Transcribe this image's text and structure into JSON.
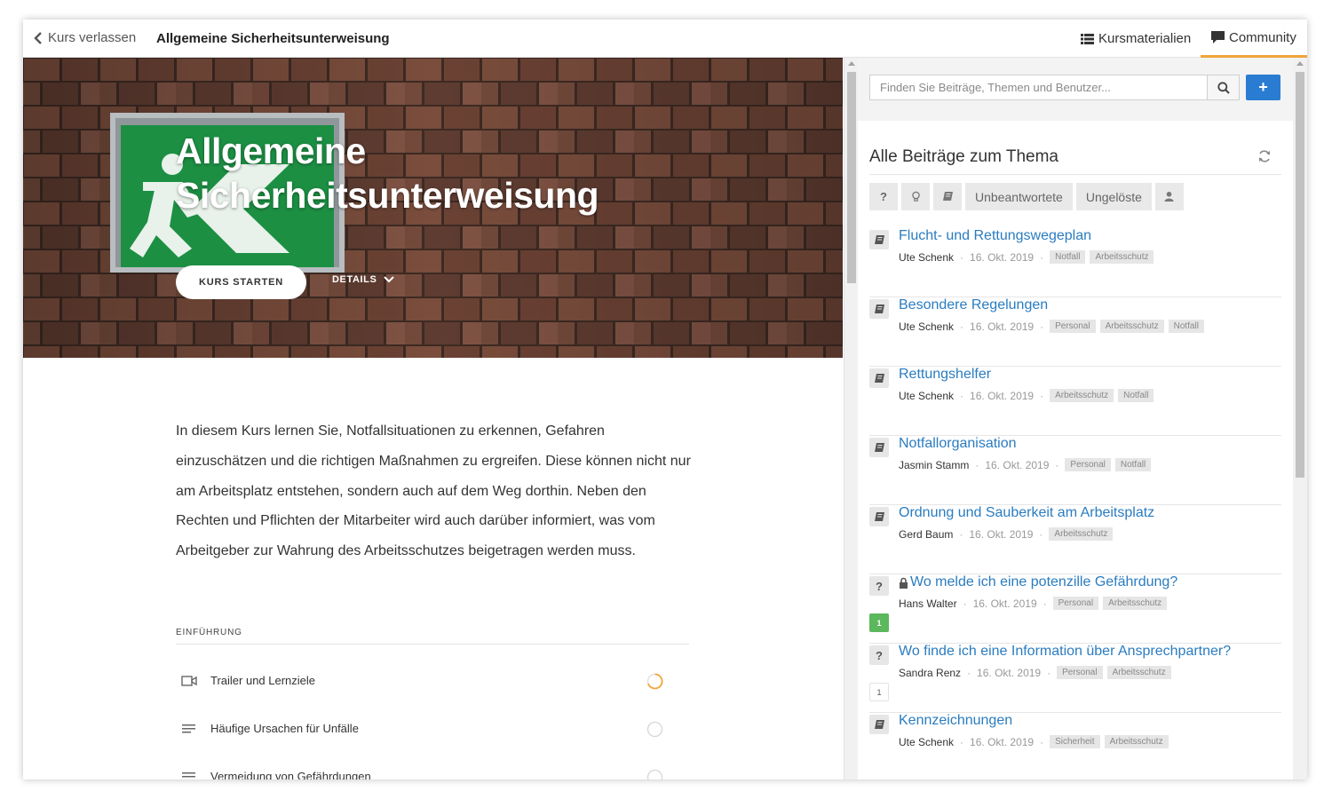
{
  "topbar": {
    "back_label": "Kurs verlassen",
    "course_title": "Allgemeine Sicherheitsunterweisung",
    "tabs": [
      {
        "label": "Kursmaterialien",
        "icon": "list-icon",
        "active": false
      },
      {
        "label": "Community",
        "icon": "comment-icon",
        "active": true
      }
    ],
    "active_tab_color": "#f0a53a"
  },
  "hero": {
    "title": "Allgemeine Sicherheitsunterweisung",
    "start_label": "KURS STARTEN",
    "details_label": "DETAILS"
  },
  "course": {
    "description": "In diesem Kurs lernen Sie, Notfallsituationen zu erkennen, Gefahren einzuschätzen und die richtigen Maßnahmen zu ergreifen. Diese können nicht nur am Arbeitsplatz entstehen, sondern auch auf dem Weg dorthin. Neben den Rechten und Pflichten der Mitarbeiter wird auch darüber informiert, was vom Arbeitgeber zur Wahrung des Arbeitsschutzes beigetragen werden muss.",
    "section_label": "EINFÜHRUNG",
    "lessons": [
      {
        "label": "Trailer und Lernziele",
        "icon": "video-icon",
        "status": "in-progress"
      },
      {
        "label": "Häufige Ursachen für Unfälle",
        "icon": "text-lines-icon",
        "status": "not-started"
      },
      {
        "label": "Vermeidung von Gefährdungen",
        "icon": "text-lines-icon",
        "status": "not-started"
      }
    ],
    "progress_color": "#f0a53a"
  },
  "community": {
    "search_placeholder": "Finden Sie Beiträge, Themen und Benutzer...",
    "add_label": "+",
    "heading": "Alle Beiträge zum Thema",
    "filters": [
      {
        "label": "?",
        "icon": "question-icon"
      },
      {
        "label": "",
        "icon": "lightbulb-icon"
      },
      {
        "label": "",
        "icon": "book-icon"
      },
      {
        "label": "Unbeantwortete"
      },
      {
        "label": "Ungelöste"
      },
      {
        "label": "",
        "icon": "user-icon"
      }
    ],
    "link_color": "#2a7cc0",
    "topics": [
      {
        "title": "Flucht- und Rettungswegeplan",
        "type": "article",
        "author": "Ute Schenk",
        "date": "16. Okt. 2019",
        "tags": [
          "Notfall",
          "Arbeitsschutz"
        ]
      },
      {
        "title": "Besondere Regelungen",
        "type": "article",
        "author": "Ute Schenk",
        "date": "16. Okt. 2019",
        "tags": [
          "Personal",
          "Arbeitsschutz",
          "Notfall"
        ]
      },
      {
        "title": "Rettungshelfer",
        "type": "article",
        "author": "Ute Schenk",
        "date": "16. Okt. 2019",
        "tags": [
          "Arbeitsschutz",
          "Notfall"
        ]
      },
      {
        "title": "Notfallorganisation",
        "type": "article",
        "author": "Jasmin Stamm",
        "date": "16. Okt. 2019",
        "tags": [
          "Personal",
          "Notfall"
        ]
      },
      {
        "title": "Ordnung und Sauberkeit am Arbeitsplatz",
        "type": "article",
        "author": "Gerd Baum",
        "date": "16. Okt. 2019",
        "tags": [
          "Arbeitsschutz"
        ]
      },
      {
        "title": "Wo melde ich eine potenzille Gefährdung?",
        "type": "question",
        "locked": true,
        "answers": "1",
        "solved": true,
        "author": "Hans Walter",
        "date": "16. Okt. 2019",
        "tags": [
          "Personal",
          "Arbeitsschutz"
        ]
      },
      {
        "title": "Wo finde ich eine Information über Ansprechpartner?",
        "type": "question",
        "answers": "1",
        "solved": false,
        "author": "Sandra Renz",
        "date": "16. Okt. 2019",
        "tags": [
          "Personal",
          "Arbeitsschutz"
        ]
      },
      {
        "title": "Kennzeichnungen",
        "type": "article",
        "author": "Ute Schenk",
        "date": "16. Okt. 2019",
        "tags": [
          "Sicherheit",
          "Arbeitsschutz"
        ]
      }
    ]
  }
}
